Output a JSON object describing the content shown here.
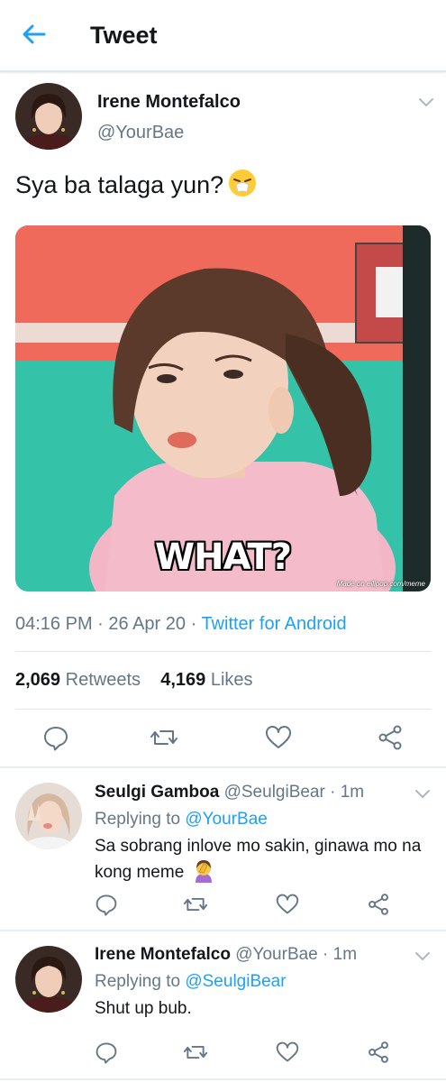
{
  "header": {
    "title": "Tweet"
  },
  "tweet": {
    "author_name": "Irene Montefalco",
    "author_handle": "@YourBae",
    "text": "Sya ba talaga yun?",
    "emoji": "😤",
    "media_caption": "WHAT?",
    "media_watermark": "Made on eilipop.com/meme",
    "time": "04:16 PM",
    "date": "26 Apr 20",
    "source": "Twitter for Android",
    "retweet_count": "2,069",
    "retweet_label": "Retweets",
    "like_count": "4,169",
    "like_label": "Likes"
  },
  "replies": [
    {
      "author_name": "Seulgi Gamboa",
      "author_handle": "@SeulgiBear",
      "time_ago": "1m",
      "replying_label": "Replying to",
      "replying_to": "@YourBae",
      "text": "Sa sobrang inlove mo sakin, ginawa mo na kong meme",
      "emoji": "🤦‍♀️"
    },
    {
      "author_name": "Irene Montefalco",
      "author_handle": "@YourBae",
      "time_ago": "1m",
      "replying_label": "Replying to",
      "replying_to": "@SeulgiBear",
      "text": "Shut up bub.",
      "emoji": ""
    }
  ],
  "colors": {
    "accent": "#1da1f2",
    "muted": "#657786",
    "divider": "#e1e8ed"
  },
  "icons": {
    "back": "arrow-left-icon",
    "reply": "reply-icon",
    "retweet": "retweet-icon",
    "like": "heart-icon",
    "share": "share-icon",
    "menu": "chevron-down-icon"
  }
}
